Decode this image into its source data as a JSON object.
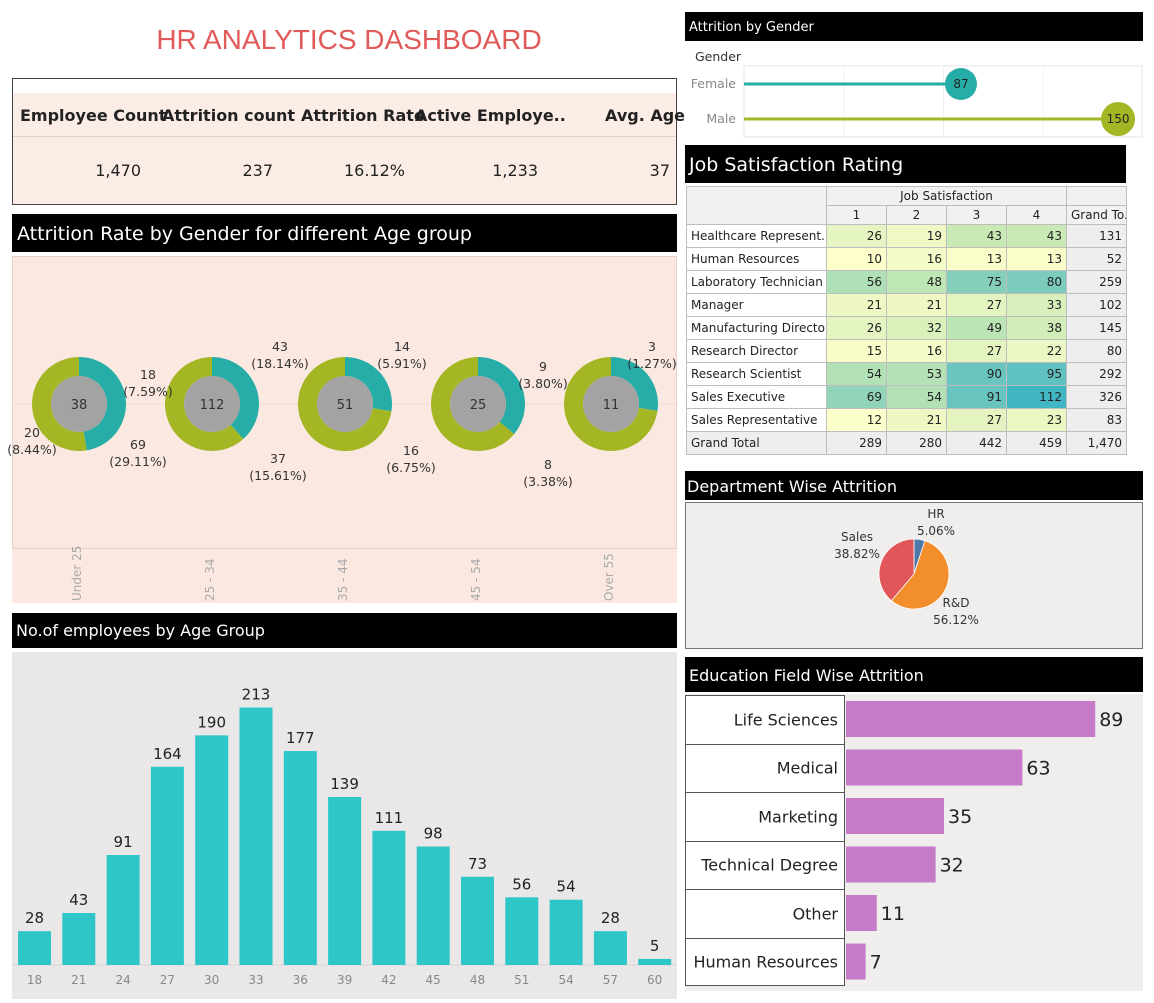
{
  "title": "HR ANALYTICS DASHBOARD",
  "kpis": [
    {
      "label": "Employee Count",
      "value": "1,470"
    },
    {
      "label": "Attrition count",
      "value": "237"
    },
    {
      "label": "Attrition Rate",
      "value": "16.12%"
    },
    {
      "label": "Active Employe..",
      "value": "1,233"
    },
    {
      "label": "Avg. Age",
      "value": "37"
    }
  ],
  "colors": {
    "teal": "#26ada7",
    "olive": "#a4b624",
    "center_gray": "#a3a3a3",
    "hist_bar": "#2ec6c7",
    "edu_bar": "#c67bc9",
    "pie_red": "#e15759",
    "pie_orange": "#f28e2b",
    "pie_blue": "#4e79a7",
    "title_red": "#e05a5a"
  },
  "donut_section": {
    "header": "Attrition Rate by Gender for different Age group"
  },
  "histogram_section": {
    "header": "No.of employees by Age Group"
  },
  "gender_section": {
    "header": "Attrition by Gender",
    "axis_label": "Gender"
  },
  "job_sat": {
    "header": "Job Satisfaction Rating",
    "super_header": "Job Satisfaction",
    "columns": [
      "1",
      "2",
      "3",
      "4",
      "Grand To.."
    ],
    "rows": [
      {
        "label": "Healthcare Represent..",
        "values": [
          "26",
          "19",
          "43",
          "43"
        ],
        "total": "131"
      },
      {
        "label": "Human Resources",
        "values": [
          "10",
          "16",
          "13",
          "13"
        ],
        "total": "52"
      },
      {
        "label": "Laboratory Technician",
        "values": [
          "56",
          "48",
          "75",
          "80"
        ],
        "total": "259"
      },
      {
        "label": "Manager",
        "values": [
          "21",
          "21",
          "27",
          "33"
        ],
        "total": "102"
      },
      {
        "label": "Manufacturing Director",
        "values": [
          "26",
          "32",
          "49",
          "38"
        ],
        "total": "145"
      },
      {
        "label": "Research Director",
        "values": [
          "15",
          "16",
          "27",
          "22"
        ],
        "total": "80"
      },
      {
        "label": "Research Scientist",
        "values": [
          "54",
          "53",
          "90",
          "95"
        ],
        "total": "292"
      },
      {
        "label": "Sales Executive",
        "values": [
          "69",
          "54",
          "91",
          "112"
        ],
        "total": "326"
      },
      {
        "label": "Sales Representative",
        "values": [
          "12",
          "21",
          "27",
          "23"
        ],
        "total": "83"
      }
    ],
    "grand_total": {
      "label": "Grand Total",
      "values": [
        "289",
        "280",
        "442",
        "459"
      ],
      "total": "1,470"
    }
  },
  "dept_section": {
    "header": "Department Wise Attrition"
  },
  "edu_section": {
    "header": "Education Field Wise Attrition"
  },
  "chart_data": [
    {
      "type": "pie",
      "title": "Attrition Rate by Gender for different Age group",
      "groups": [
        {
          "category": "Under 25",
          "total": "38",
          "teal": {
            "value": 18,
            "label": "18",
            "pct": "(7.59%)"
          },
          "olive": {
            "value": 20,
            "label": "20",
            "pct": "(8.44%)"
          }
        },
        {
          "category": "25 - 34",
          "total": "112",
          "teal": {
            "value": 43,
            "label": "43",
            "pct": "(18.14%)"
          },
          "olive": {
            "value": 69,
            "label": "69",
            "pct": "(29.11%)"
          }
        },
        {
          "category": "35 - 44",
          "total": "51",
          "teal": {
            "value": 14,
            "label": "14",
            "pct": "(5.91%)"
          },
          "olive": {
            "value": 37,
            "label": "37",
            "pct": "(15.61%)"
          }
        },
        {
          "category": "45 - 54",
          "total": "25",
          "teal": {
            "value": 9,
            "label": "9",
            "pct": "(3.80%)"
          },
          "olive": {
            "value": 16,
            "label": "16",
            "pct": "(6.75%)"
          }
        },
        {
          "category": "Over 55",
          "total": "11",
          "teal": {
            "value": 3,
            "label": "3",
            "pct": "(1.27%)"
          },
          "olive": {
            "value": 8,
            "label": "8",
            "pct": "(3.38%)"
          }
        }
      ]
    },
    {
      "type": "bar",
      "title": "No.of employees by Age Group",
      "categories": [
        "18",
        "21",
        "24",
        "27",
        "30",
        "33",
        "36",
        "39",
        "42",
        "45",
        "48",
        "51",
        "54",
        "57",
        "60"
      ],
      "values": [
        28,
        43,
        91,
        164,
        190,
        213,
        177,
        139,
        111,
        98,
        73,
        56,
        54,
        28,
        5
      ],
      "ylim": [
        0,
        230
      ]
    },
    {
      "type": "scatter",
      "title": "Attrition by Gender",
      "ylabel": "Gender",
      "categories": [
        "Female",
        "Male"
      ],
      "values": [
        87,
        150
      ],
      "xlim": [
        0,
        160
      ]
    },
    {
      "type": "pie",
      "title": "Department Wise Attrition",
      "slices": [
        {
          "name": "HR",
          "value": 5.06,
          "label": "5.06%"
        },
        {
          "name": "R&D",
          "value": 56.12,
          "label": "56.12%"
        },
        {
          "name": "Sales",
          "value": 38.82,
          "label": "38.82%"
        }
      ]
    },
    {
      "type": "bar",
      "title": "Education Field Wise Attrition",
      "categories": [
        "Life Sciences",
        "Medical",
        "Marketing",
        "Technical Degree",
        "Other",
        "Human Resources"
      ],
      "values": [
        89,
        63,
        35,
        32,
        11,
        7
      ],
      "xlim": [
        0,
        100
      ]
    }
  ]
}
